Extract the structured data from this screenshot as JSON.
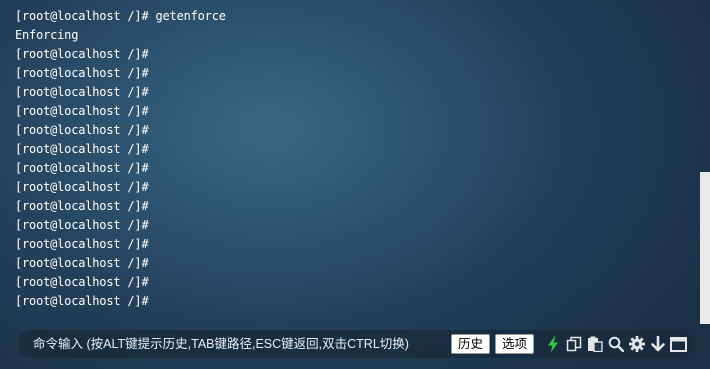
{
  "terminal": {
    "lines": [
      "[root@localhost /]# getenforce",
      "Enforcing",
      "[root@localhost /]#",
      "[root@localhost /]#",
      "[root@localhost /]#",
      "[root@localhost /]#",
      "[root@localhost /]#",
      "[root@localhost /]#",
      "[root@localhost /]#",
      "[root@localhost /]#",
      "[root@localhost /]#",
      "[root@localhost /]#",
      "[root@localhost /]#",
      "[root@localhost /]#",
      "[root@localhost /]#",
      "[root@localhost /]#"
    ]
  },
  "command_bar": {
    "placeholder": "命令输入 (按ALT键提示历史,TAB键路径,ESC键返回,双击CTRL切换)",
    "history_label": "历史",
    "options_label": "选项",
    "icons": [
      "lightning-icon",
      "copy-icon",
      "paste-icon",
      "search-icon",
      "gear-icon",
      "arrow-down-icon",
      "window-icon"
    ]
  },
  "colors": {
    "text": "#ffffff",
    "lightning": "#2ecc40",
    "icon": "#e6e6e6"
  }
}
